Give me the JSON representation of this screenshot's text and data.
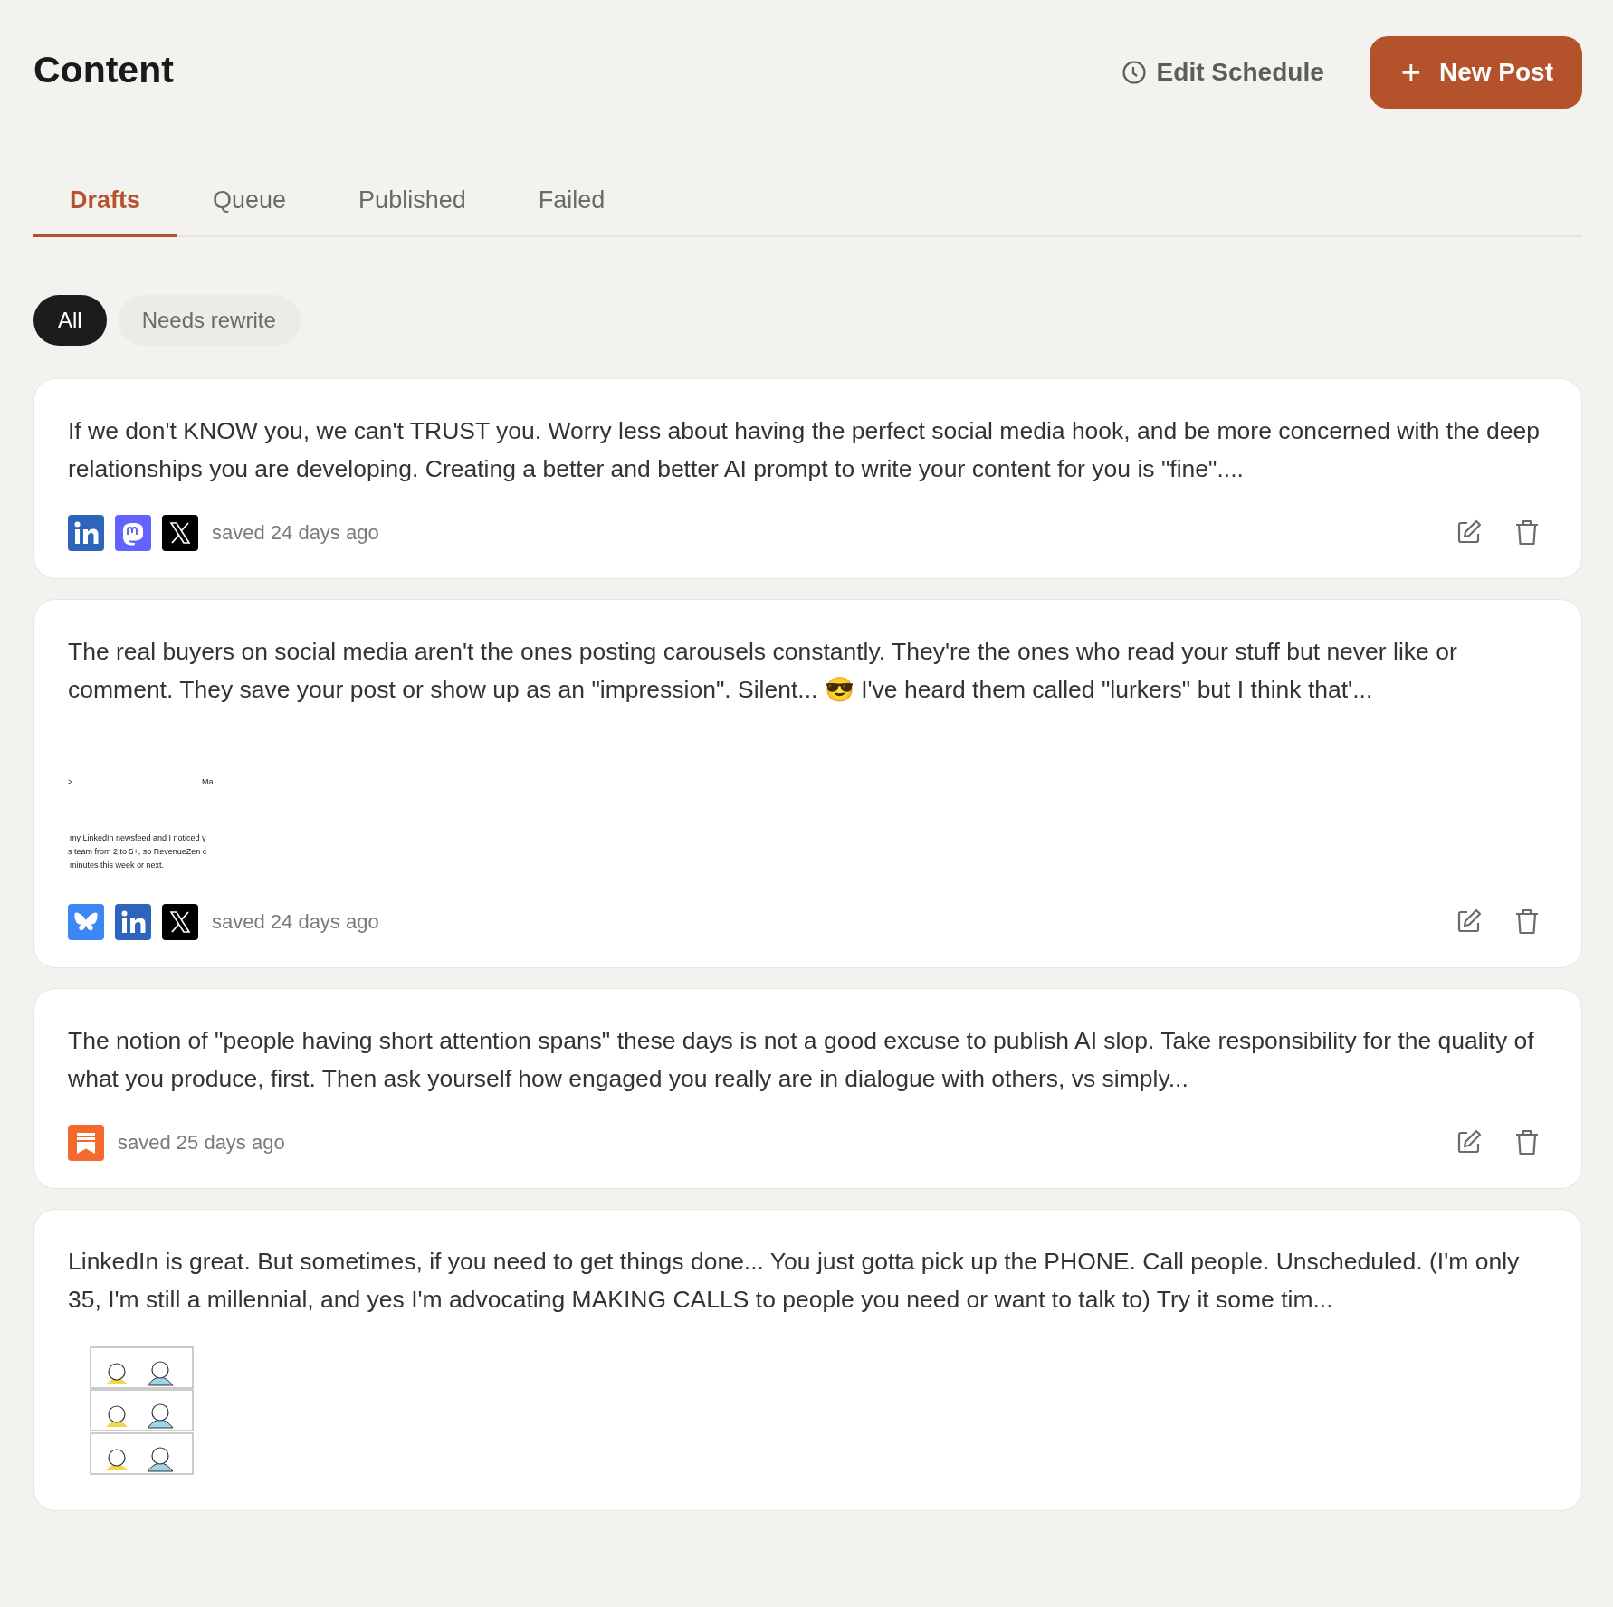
{
  "header": {
    "title": "Content",
    "edit_schedule": "Edit Schedule",
    "new_post": "New Post",
    "new_post_icon": "+"
  },
  "tabs": [
    {
      "label": "Drafts",
      "selected": true
    },
    {
      "label": "Queue",
      "selected": false
    },
    {
      "label": "Published",
      "selected": false
    },
    {
      "label": "Failed",
      "selected": false
    }
  ],
  "filters": [
    {
      "label": "All",
      "selected": true
    },
    {
      "label": "Needs rewrite",
      "selected": false
    }
  ],
  "posts": [
    {
      "text": "If we don't KNOW you, we can't TRUST you. Worry less about having the perfect social media hook, and be more concerned with the deep relationships you are developing. Creating a better and better AI prompt to write your content for you is \"fine\"....",
      "platforms": [
        {
          "kind": "linkedin"
        },
        {
          "kind": "mastodon"
        },
        {
          "kind": "x"
        }
      ],
      "saved": "saved 24 days ago"
    },
    {
      "text": "The real buyers on social media aren't the ones posting carousels constantly. They're the ones who read your stuff but never like or comment. They save your post or show up as an \"impression\". Silent... 😎 I've heard them called \"lurkers\" but I think that'...",
      "attachment": {
        "kind": "document",
        "top_left": ">",
        "top_right": "Ma",
        "lines": [
          "my LinkedIn newsfeed and I noticed y",
          "s team from 2 to 5+, so RevenueZen c",
          "minutes this week or next."
        ]
      },
      "platforms": [
        {
          "kind": "bluesky"
        },
        {
          "kind": "linkedin"
        },
        {
          "kind": "x"
        }
      ],
      "saved": "saved 24 days ago"
    },
    {
      "text": "The notion of \"people having short attention spans\" these days is not a good excuse to publish AI slop. Take responsibility for the quality of what you produce, first. Then ask yourself how engaged you really are in dialogue with others, vs simply...",
      "platforms": [
        {
          "kind": "substack"
        }
      ],
      "saved": "saved 25 days ago"
    },
    {
      "text": "LinkedIn is great. But sometimes, if you need to get things done... You just gotta pick up the PHONE. Call people. Unscheduled. (I'm only 35, I'm still a millennial, and yes I'm advocating MAKING CALLS to people you need or want to talk to) Try it some tim..."
    }
  ]
}
